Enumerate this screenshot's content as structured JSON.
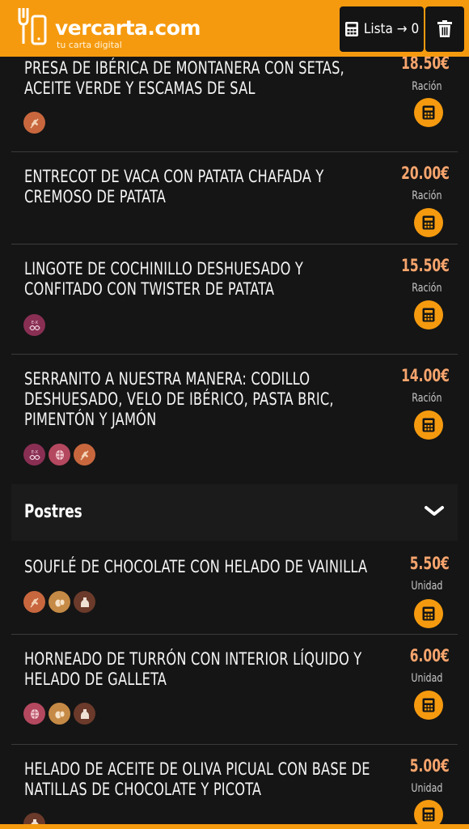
{
  "header": {
    "logo_name": "vercarta.com",
    "logo_tagline": "tu carta digital",
    "list_label": "Lista → 0",
    "trash_icon": "trash-icon",
    "calculator_icon": "calculator-icon",
    "accent_color": "#f59a0f"
  },
  "items_top": [
    {
      "name": "PRESA DE IBÉRICA DE MONTANERA CON SETAS, ACEITE VERDE Y ESCAMAS DE SAL",
      "price": "18.50€",
      "unit": "Ración",
      "allergens": [
        "gluten"
      ]
    },
    {
      "name": "ENTRECOT DE VACA CON PATATA CHAFADA Y CREMOSO DE PATATA",
      "price": "20.00€",
      "unit": "Ración",
      "allergens": []
    },
    {
      "name": "LINGOTE DE COCHINILLO DESHUESADO Y CONFITADO CON TWISTER DE PATATA",
      "price": "15.50€",
      "unit": "Ración",
      "allergens": [
        "sulphites"
      ]
    },
    {
      "name": "SERRANITO A NUESTRA MANERA: CODILLO DESHUESADO, VELO DE IBÉRICO, PASTA BRIC, PIMENTÓN Y JAMÓN",
      "price": "14.00€",
      "unit": "Ración",
      "allergens": [
        "sulphites",
        "nuts",
        "gluten"
      ]
    }
  ],
  "section": {
    "title": "Postres",
    "icon": "chevron-down-icon"
  },
  "items_postres": [
    {
      "name": "SOUFLÉ DE CHOCOLATE CON HELADO DE VAINILLA",
      "price": "5.50€",
      "unit": "Unidad",
      "allergens": [
        "gluten",
        "eggs",
        "milk"
      ]
    },
    {
      "name": "HORNEADO DE TURRÓN CON INTERIOR LÍQUIDO Y HELADO DE GALLETA",
      "price": "6.00€",
      "unit": "Unidad",
      "allergens": [
        "nuts",
        "eggs",
        "milk"
      ]
    },
    {
      "name": "HELADO DE ACEITE DE OLIVA PICUAL CON BASE DE NATILLAS DE CHOCOLATE Y PICOTA",
      "price": "5.00€",
      "unit": "Unidad",
      "allergens": [
        "milk"
      ]
    }
  ]
}
